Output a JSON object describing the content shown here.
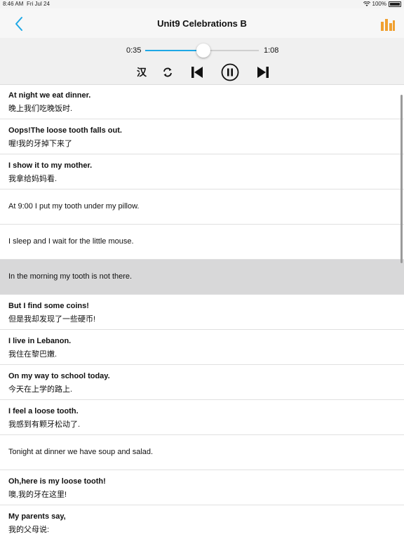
{
  "status": {
    "time": "8:46 AM",
    "date": "Fri Jul 24",
    "battery": "100%"
  },
  "nav": {
    "title": "Unit9 Celebrations B"
  },
  "player": {
    "current_time": "0:35",
    "total_time": "1:08",
    "progress": 0.51,
    "han_label": "汉"
  },
  "colors": {
    "accent": "#1ea8e6",
    "chart_icon": "#f0a030",
    "highlight_row": "#d8d8d9"
  },
  "lines": [
    {
      "en": "At night we eat dinner.",
      "zh": "晚上我们吃晚饭时."
    },
    {
      "en": "Oops!The loose tooth falls out.",
      "zh": "喔!我的牙掉下来了"
    },
    {
      "en": "I show it to my mother.",
      "zh": "我拿给妈妈看."
    },
    {
      "en": "At 9:00 I put my tooth under my pillow.",
      "zh": ""
    },
    {
      "en": "I sleep and I wait for the little mouse.",
      "zh": ""
    },
    {
      "en": "In the morning my tooth is not there.",
      "zh": "",
      "highlighted": true
    },
    {
      "en": "But I find some coins!",
      "zh": "但是我却发现了一些硬币!"
    },
    {
      "en": "I live in Lebanon.",
      "zh": "我住在黎巴嫩."
    },
    {
      "en": "On my way to school today.",
      "zh": "今天在上学的路上."
    },
    {
      "en": "I feel a loose tooth.",
      "zh": "我感到有颗牙松动了."
    },
    {
      "en": "Tonight at dinner we have soup and salad.",
      "zh": ""
    },
    {
      "en": "Oh,here is my loose tooth!",
      "zh": "噢,我的牙在这里!"
    },
    {
      "en": "My parents say,",
      "zh": "我的父母说:"
    }
  ]
}
